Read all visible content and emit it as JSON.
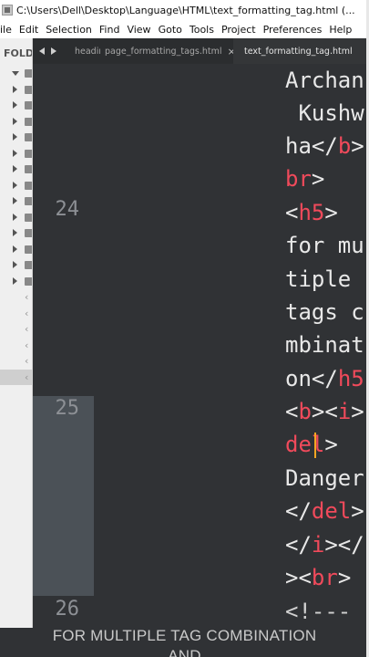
{
  "window": {
    "title": "C:\\Users\\Dell\\Desktop\\Language\\HTML\\text_formatting_tag.html (..."
  },
  "menu": [
    "ile",
    "Edit",
    "Selection",
    "Find",
    "View",
    "Goto",
    "Tools",
    "Project",
    "Preferences",
    "Help"
  ],
  "sidebar": {
    "header": "FOLD",
    "rows": [
      "folder-open",
      "folder",
      "folder",
      "folder",
      "folder",
      "folder",
      "folder",
      "folder",
      "folder",
      "folder",
      "folder",
      "folder",
      "folder",
      "folder",
      "file",
      "file",
      "file",
      "file",
      "file",
      "file-selected"
    ]
  },
  "tabs": [
    {
      "label": "heading.",
      "active": false
    },
    {
      "label": "page_formatting_tags.html",
      "active": false
    },
    {
      "label": "text_formatting_tag.html",
      "active": true
    }
  ],
  "tab_close_glyph": "×",
  "editor": {
    "line_numbers": [
      "24",
      "25",
      "26"
    ],
    "lines": [
      [
        {
          "t": "Archan",
          "c": "txt"
        }
      ],
      [
        {
          "t": " Kushw",
          "c": "txt"
        }
      ],
      [
        {
          "t": "ha",
          "c": "txt"
        },
        {
          "t": "</",
          "c": "punc"
        },
        {
          "t": "b",
          "c": "tag"
        },
        {
          "t": ">",
          "c": "punc"
        }
      ],
      [
        {
          "t": "br",
          "c": "tag"
        },
        {
          "t": ">",
          "c": "punc"
        }
      ],
      [
        {
          "t": "<",
          "c": "punc"
        },
        {
          "t": "h5",
          "c": "tag"
        },
        {
          "t": ">",
          "c": "punc"
        }
      ],
      [
        {
          "t": "for mu",
          "c": "txt"
        }
      ],
      [
        {
          "t": "tiple ",
          "c": "txt"
        }
      ],
      [
        {
          "t": "tags c",
          "c": "txt"
        }
      ],
      [
        {
          "t": "mbinat",
          "c": "txt"
        }
      ],
      [
        {
          "t": "on",
          "c": "txt"
        },
        {
          "t": "</",
          "c": "punc"
        },
        {
          "t": "h5",
          "c": "tag"
        }
      ],
      [
        {
          "t": "<",
          "c": "punc"
        },
        {
          "t": "b",
          "c": "tag"
        },
        {
          "t": "><",
          "c": "punc"
        },
        {
          "t": "i",
          "c": "tag"
        },
        {
          "t": ">",
          "c": "punc"
        }
      ],
      [
        {
          "t": "del",
          "c": "tag"
        },
        {
          "t": ">",
          "c": "punc"
        }
      ],
      [
        {
          "t": "Danger",
          "c": "txt"
        }
      ],
      [
        {
          "t": "</",
          "c": "punc"
        },
        {
          "t": "del",
          "c": "tag"
        },
        {
          "t": ">",
          "c": "punc"
        }
      ],
      [
        {
          "t": "</",
          "c": "punc"
        },
        {
          "t": "i",
          "c": "tag"
        },
        {
          "t": "></",
          "c": "punc"
        }
      ],
      [
        {
          "t": "><",
          "c": "punc"
        },
        {
          "t": "br",
          "c": "tag"
        },
        {
          "t": ">",
          "c": "punc"
        }
      ],
      [
        {
          "t": "<!---",
          "c": "cmt"
        }
      ]
    ]
  },
  "caption": {
    "line1": "FOR MULTIPLE TAG COMBINATION",
    "line2": "AND"
  },
  "colors": {
    "editor_bg": "#303235",
    "tag": "#f04a5b",
    "text": "#e8e8e8",
    "cursor": "#f5a623",
    "gutter_highlight": "#4b5157"
  }
}
